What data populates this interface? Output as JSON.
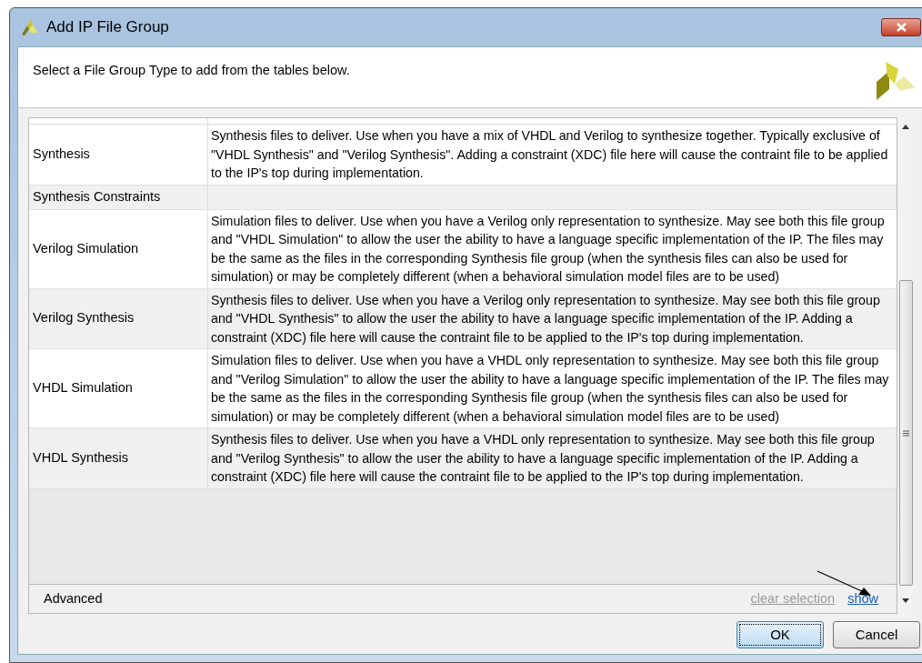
{
  "window": {
    "title": "Add IP File Group"
  },
  "header": {
    "instruction": "Select a File Group Type to add from the tables below."
  },
  "table": {
    "rows": [
      {
        "name": "Synthesis",
        "description": "Synthesis files to deliver. Use when you have a mix of VHDL and Verilog to synthesize together. Typically exclusive of \"VHDL Synthesis\" and \"Verilog Synthesis\". Adding a constraint (XDC) file here will cause the contraint file to be applied to the IP's top during implementation."
      },
      {
        "name": "Synthesis Constraints"
      },
      {
        "name": "Verilog Simulation",
        "description": "Simulation files to deliver. Use when you have a Verilog only representation to synthesize. May see both this file group and \"VHDL Simulation\" to allow the user the ability to have a language specific implementation of the IP. The files may be the same as the files in the corresponding Synthesis file group (when the synthesis files can also be used for simulation) or may be completely different (when a behavioral simulation model files are to be used)"
      },
      {
        "name": "Verilog Synthesis",
        "description": "Synthesis files to deliver. Use when you have a Verilog only representation to synthesize. May see both this file group and \"VHDL Synthesis\" to allow the user the ability to have a language specific implementation of the IP. Adding a constraint (XDC) file here will cause the contraint file to be applied to the IP's top during implementation."
      },
      {
        "name": "VHDL Simulation",
        "description": "Simulation files to deliver. Use when you have a VHDL only representation to synthesize. May see both this file group and \"Verilog Simulation\" to allow the user the ability to have a language specific implementation of the IP. The files may be the same as the files in the corresponding Synthesis file group (when the synthesis files can also be used for simulation) or may be completely different (when a behavioral simulation model files are to be used)"
      },
      {
        "name": "VHDL Synthesis",
        "description": "Synthesis files to deliver. Use when you have a VHDL only representation to synthesize. May see both this file group and \"Verilog Synthesis\" to allow the user the ability to have a language specific implementation of the IP. Adding a constraint (XDC) file here will cause the contraint file to be applied to the IP's top during implementation."
      }
    ]
  },
  "advanced": {
    "label": "Advanced",
    "links": [
      {
        "label": "clear selection",
        "disabled": true
      },
      {
        "label": "show",
        "disabled": false
      }
    ]
  },
  "buttons": [
    {
      "label": "OK",
      "default": true
    },
    {
      "label": "Cancel",
      "default": false
    }
  ]
}
